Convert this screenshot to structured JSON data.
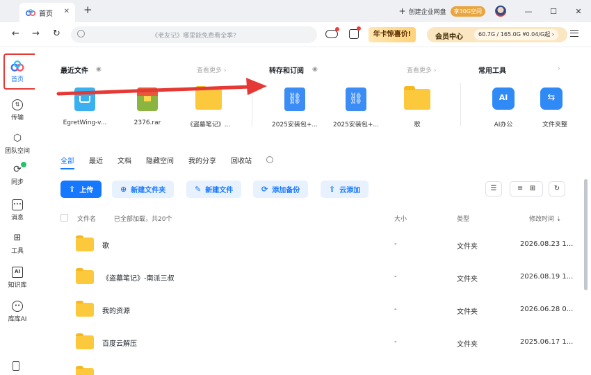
{
  "titlebar": {
    "tab_label": "首页",
    "new_tab": "+",
    "enterprise_label": "创建企业网盘",
    "enterprise_badge": "享30G空间",
    "minimize": "—",
    "maximize": "☐",
    "close": "✕"
  },
  "navbar": {
    "search_placeholder": "《老友记》哪里能免费看全季?",
    "promo_label": "年卡惊喜价!",
    "member_label": "会员中心",
    "member_info": "60.7G / 165.0G  ¥0.04/G起 ›"
  },
  "sidebar": {
    "items": [
      {
        "label": "首页",
        "icon": "home-icon"
      },
      {
        "label": "传输",
        "icon": "transfer-icon"
      },
      {
        "label": "团队空间",
        "icon": "team-icon"
      },
      {
        "label": "同步",
        "icon": "sync-icon"
      },
      {
        "label": "消息",
        "icon": "message-icon"
      },
      {
        "label": "工具",
        "icon": "tools-icon"
      },
      {
        "label": "知识库",
        "icon": "knowledge-icon"
      },
      {
        "label": "库库AI",
        "icon": "ai-icon"
      }
    ]
  },
  "recent": {
    "title": "最近文件",
    "more": "查看更多 ›",
    "files": [
      {
        "name": "EgretWing-v..."
      },
      {
        "name": "2376.rar"
      },
      {
        "name": "《盗墓笔记》..."
      }
    ]
  },
  "transfer": {
    "title": "转存和订阅",
    "more": "查看更多 ›",
    "files": [
      {
        "name": "2025安装包+..."
      },
      {
        "name": "2025安装包+..."
      },
      {
        "name": "歌"
      }
    ]
  },
  "tools": {
    "title": "常用工具",
    "more": "›",
    "items": [
      {
        "name": "AI办公"
      },
      {
        "name": "文件夹整"
      }
    ]
  },
  "filter_tabs": [
    "全部",
    "最近",
    "文档",
    "隐藏空间",
    "我的分享",
    "回收站"
  ],
  "toolbar": {
    "upload": "上传",
    "new_folder": "新建文件夹",
    "new_file": "新建文件",
    "add_backup": "添加备份",
    "cloud_add": "云添加"
  },
  "list": {
    "col_name": "文件名",
    "loaded_info": "已全部加载，共20个",
    "col_size": "大小",
    "col_type": "类型",
    "col_modified": "修改时间",
    "rows": [
      {
        "name": "歌",
        "size": "-",
        "type": "文件夹",
        "date": "2026.08.23 1..."
      },
      {
        "name": "《盗墓笔记》-南派三叔",
        "size": "-",
        "type": "文件夹",
        "date": "2026.08.19 1..."
      },
      {
        "name": "我的资源",
        "size": "-",
        "type": "文件夹",
        "date": "2026.06.28 0..."
      },
      {
        "name": "百度云解压",
        "size": "-",
        "type": "文件夹",
        "date": "2025.06.17 1..."
      }
    ]
  },
  "colors": {
    "accent": "#1677ff",
    "highlight_box": "#e53935",
    "folder": "#fcc93d"
  }
}
